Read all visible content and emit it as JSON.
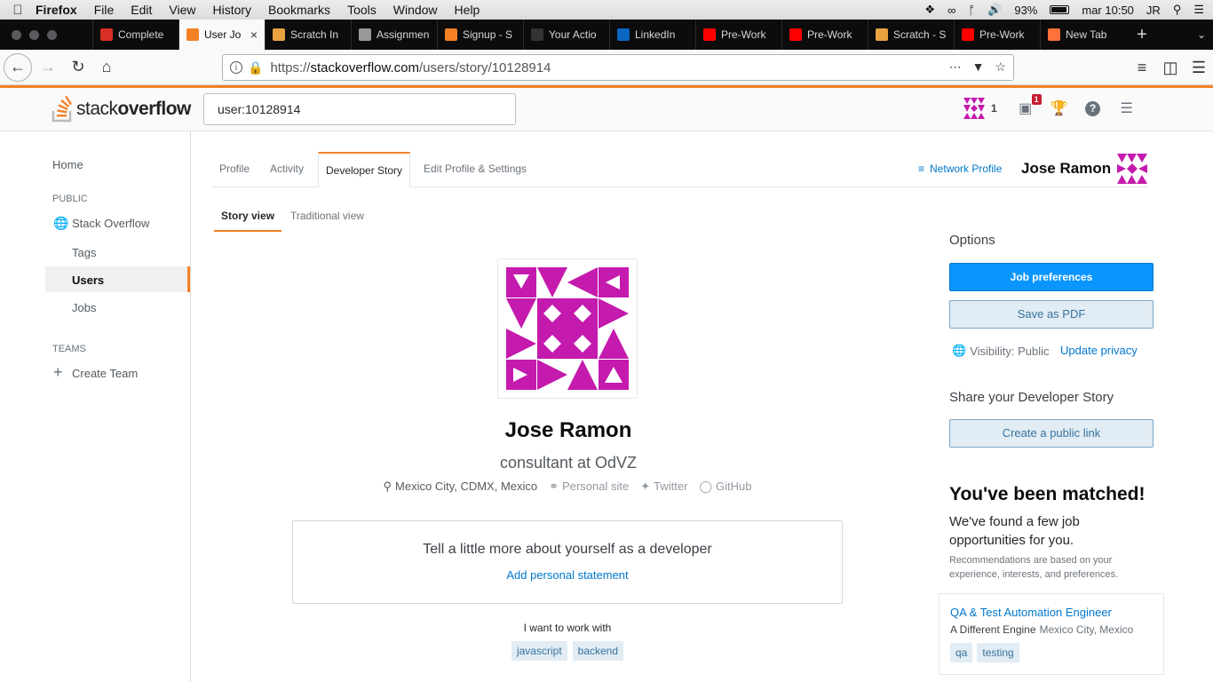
{
  "menubar": {
    "app": "Firefox",
    "items": [
      "File",
      "Edit",
      "View",
      "History",
      "Bookmarks",
      "Tools",
      "Window",
      "Help"
    ],
    "battery": "93%",
    "clock": "mar 10:50",
    "user": "JR"
  },
  "browser": {
    "tabs": [
      {
        "label": "Complete",
        "icon": "gmail-icon",
        "color": "#d93025"
      },
      {
        "label": "User Jo",
        "icon": "stackoverflow-icon",
        "color": "#f48024",
        "active": true
      },
      {
        "label": "Scratch In",
        "icon": "scratch-icon",
        "color": "#e8a240"
      },
      {
        "label": "Assignmen",
        "icon": "book-icon",
        "color": "#999"
      },
      {
        "label": "Signup - S",
        "icon": "stackoverflow-icon",
        "color": "#f48024"
      },
      {
        "label": "Your Actio",
        "icon": "github-icon",
        "color": "#333"
      },
      {
        "label": "LinkedIn",
        "icon": "linkedin-icon",
        "color": "#0a66c2"
      },
      {
        "label": "Pre-Work",
        "icon": "youtube-icon",
        "color": "#ff0000"
      },
      {
        "label": "Pre-Work",
        "icon": "youtube-icon",
        "color": "#ff0000"
      },
      {
        "label": "Scratch - S",
        "icon": "scratch-icon",
        "color": "#e8a240"
      },
      {
        "label": "Pre-Work",
        "icon": "youtube-icon",
        "color": "#ff0000"
      },
      {
        "label": "New Tab",
        "icon": "firefox-icon",
        "color": "#ff7139"
      }
    ],
    "url_scheme": "https://",
    "url_host": "stackoverflow.com",
    "url_path": "/users/story/10128914"
  },
  "so": {
    "search_value": "user:10128914",
    "reputation": "1",
    "inbox_count": "1",
    "accent": "#f48024",
    "user_avatar_color": "#c41aad"
  },
  "leftnav": {
    "home": "Home",
    "public_head": "PUBLIC",
    "stack_overflow": "Stack Overflow",
    "tags": "Tags",
    "users": "Users",
    "jobs": "Jobs",
    "teams_head": "TEAMS",
    "create_team": "Create Team"
  },
  "profile_tabs": [
    "Profile",
    "Activity",
    "Developer Story",
    "Edit Profile & Settings"
  ],
  "story_tabs": [
    "Story view",
    "Traditional view"
  ],
  "network_profile": "Network Profile",
  "user_name": "Jose Ramon",
  "story": {
    "name": "Jose Ramon",
    "title": "consultant at OdVZ",
    "location": "Mexico City, CDMX, Mexico",
    "personal_site": "Personal site",
    "twitter": "Twitter",
    "github": "GitHub",
    "statement_prompt": "Tell a little more about yourself as a developer",
    "add_statement": "Add personal statement",
    "work_with": "I want to work with",
    "tags": [
      "javascript",
      "backend"
    ]
  },
  "sidebar": {
    "options": "Options",
    "job_preferences": "Job preferences",
    "save_pdf": "Save as PDF",
    "visibility": "Visibility: Public",
    "update_privacy": "Update privacy",
    "share_heading": "Share your Developer Story",
    "create_link": "Create a public link",
    "matched": "You've been matched!",
    "found": "We've found a few job opportunities for you.",
    "reco": "Recommendations are based on your experience, interests, and preferences.",
    "job": {
      "title": "QA & Test Automation Engineer",
      "company": "A Different Engine",
      "location": "Mexico City, Mexico",
      "tags": [
        "qa",
        "testing"
      ]
    }
  }
}
